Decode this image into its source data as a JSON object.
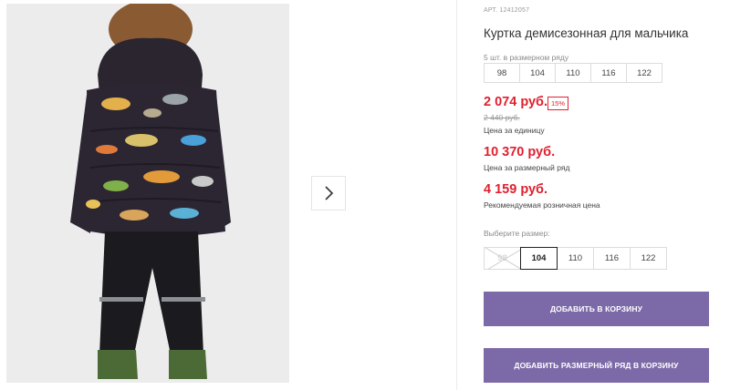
{
  "product": {
    "article": "АРТ. 12412057",
    "title": "Куртка демисезонная для мальчика"
  },
  "range": {
    "label": "5 шт. в размерном ряду",
    "sizes": [
      "98",
      "104",
      "110",
      "116",
      "122"
    ]
  },
  "prices": {
    "unit_price": "2 074 руб.",
    "discount": "15%",
    "old_price": "2 440 руб.",
    "unit_caption": "Цена за единицу",
    "range_price": "10 370 руб.",
    "range_caption": "Цена за размерный ряд",
    "retail_price": "4 159 руб.",
    "retail_caption": "Рекомендуемая розничная цена"
  },
  "size_select": {
    "label": "Выберите размер:",
    "options": [
      {
        "label": "98",
        "state": "unavailable"
      },
      {
        "label": "104",
        "state": "selected"
      },
      {
        "label": "110",
        "state": "available"
      },
      {
        "label": "116",
        "state": "available"
      },
      {
        "label": "122",
        "state": "available"
      }
    ]
  },
  "actions": {
    "add_to_cart": "ДОБАВИТЬ В КОРЗИНУ",
    "add_range_to_cart": "ДОБАВИТЬ РАЗМЕРНЫЙ РЯД В КОРЗИНУ"
  },
  "gallery": {
    "next_icon": "chevron-right-icon"
  },
  "colors": {
    "accent_button": "#7c6aa8",
    "price_red": "#e0202e"
  }
}
